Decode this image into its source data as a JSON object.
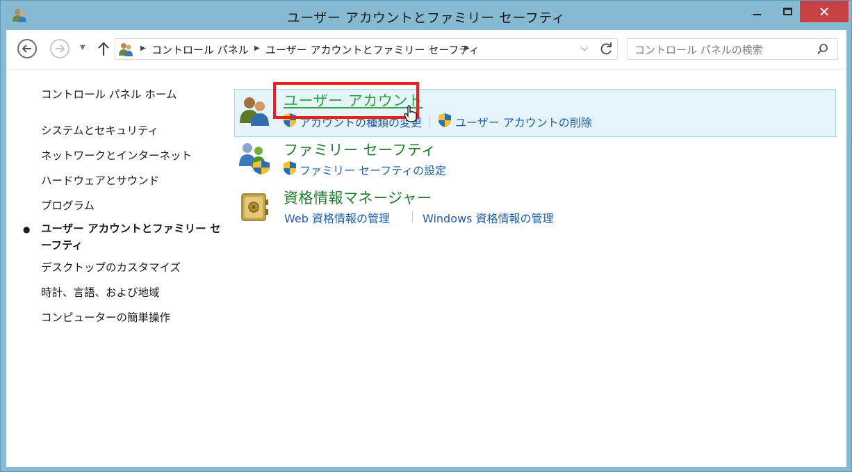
{
  "window": {
    "title": "ユーザー アカウントとファミリー セーフティ",
    "close_glyph": "✕"
  },
  "navbar": {
    "breadcrumbs": [
      "コントロール パネル",
      "ユーザー アカウントとファミリー セーフティ"
    ],
    "search_placeholder": "コントロール パネルの検索"
  },
  "sidebar": {
    "items": [
      {
        "label": "コントロール パネル ホーム"
      },
      {
        "label": "システムとセキュリティ"
      },
      {
        "label": "ネットワークとインターネット"
      },
      {
        "label": "ハードウェアとサウンド"
      },
      {
        "label": "プログラム"
      },
      {
        "label": "ユーザー アカウントとファミリー セ",
        "label2": "ーフティ",
        "active": true
      },
      {
        "label": "デスクトップのカスタマイズ"
      },
      {
        "label": "時計、言語、および地域"
      },
      {
        "label": "コンピューターの簡単操作"
      }
    ],
    "active_bullet": "●"
  },
  "categories": [
    {
      "title": "ユーザー アカウント",
      "links": [
        "アカウントの種類の変更",
        "ユーザー アカウントの削除"
      ]
    },
    {
      "title": "ファミリー セーフティ",
      "links": [
        "ファミリー セーフティの設定"
      ]
    },
    {
      "title": "資格情報マネージャー",
      "links": [
        "Web 資格情報の管理",
        "Windows 資格情報の管理"
      ]
    }
  ],
  "colors": {
    "frame": "#86bad3",
    "close": "#c74044",
    "category_title": "#1f7a2c",
    "link": "#1f5ea8",
    "highlight_box": "#e8201f"
  }
}
